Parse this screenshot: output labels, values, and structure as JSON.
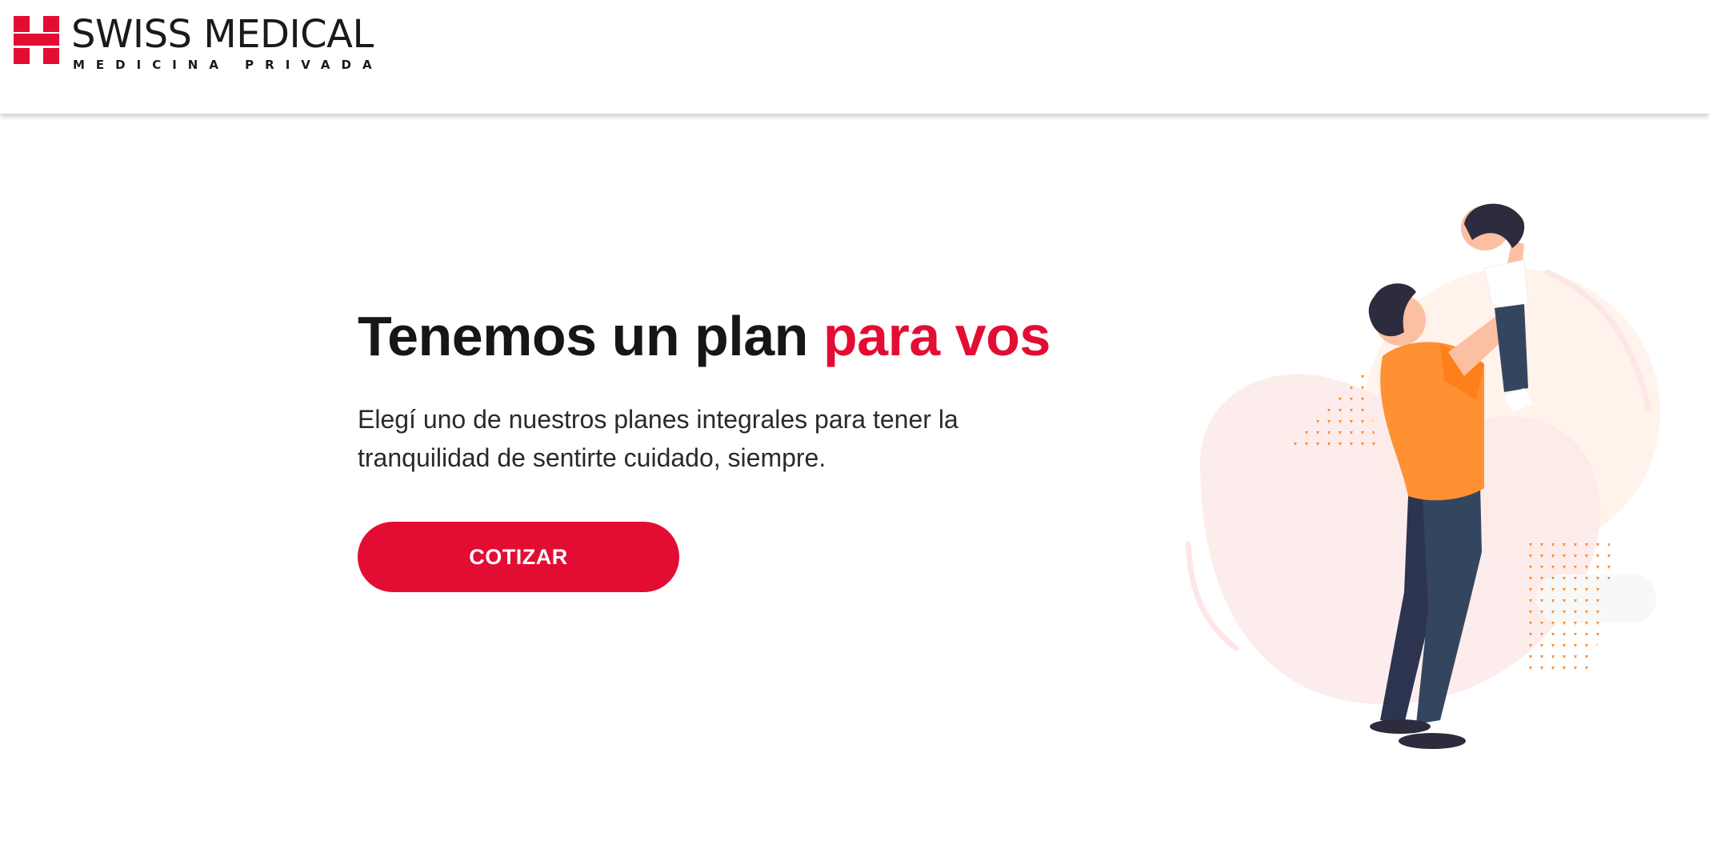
{
  "brand": {
    "name": "SWISS MEDICAL",
    "tagline": "MEDICINA PRIVADA",
    "color": "#e30d34"
  },
  "hero": {
    "title_main": "Tenemos un plan ",
    "title_accent": "para vos",
    "description": "Elegí uno de nuestros planes integrales para tener la tranquilidad de sentirte cuidado, siempre.",
    "cta_label": "COTIZAR"
  },
  "illustration": {
    "icon": "father-lifting-child-illustration",
    "colors": {
      "shirt": "#ff9133",
      "pants": "#34465f",
      "hair": "#2c2c3e",
      "skin": "#fbbfa2",
      "blob": "#fde8e8"
    }
  }
}
